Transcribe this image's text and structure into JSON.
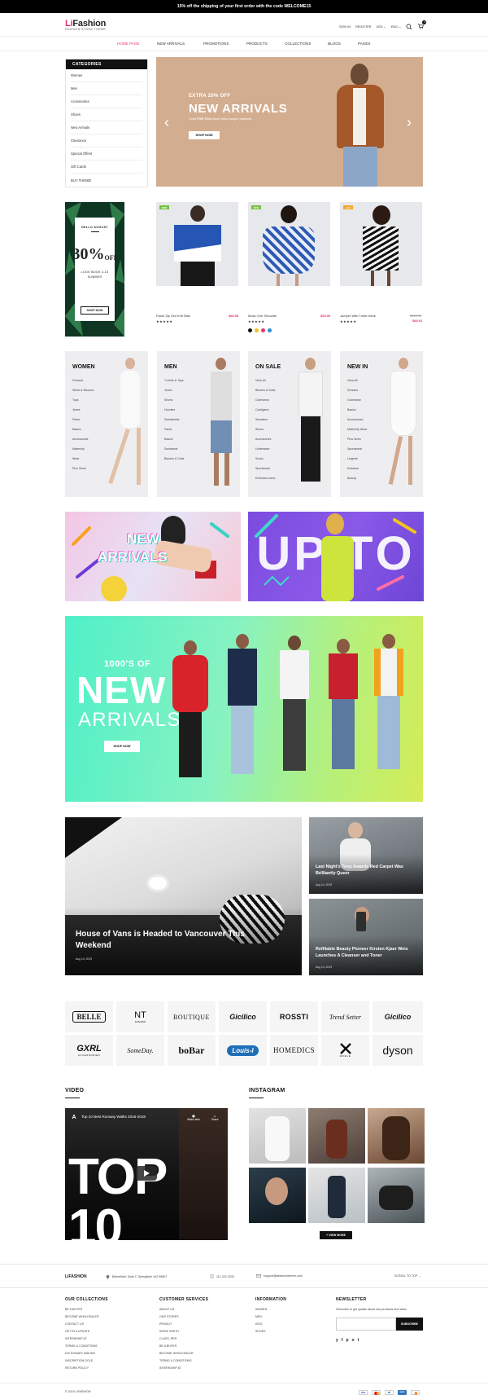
{
  "announcement": "15% off the shipping of your first order with the code WELCOME15",
  "brand": {
    "logo_prefix": "Li",
    "logo_rest": "Fashion",
    "tagline": "FASHION STORE THEME"
  },
  "header_links": {
    "sign_in": "SIGN IN",
    "register": "REGISTER",
    "currency": "USD",
    "language": "ENG",
    "cart_count": "0"
  },
  "nav": [
    "HOME PAGE",
    "NEW ARRIVALS",
    "PROMOTIONS",
    "PRODUCTS",
    "COLLECTIONS",
    "BLOGS",
    "PAGES"
  ],
  "categories": {
    "title": "CATEGORIES",
    "items": [
      "Women",
      "Men",
      "Accessories",
      "Shoes",
      "New Arrivals",
      "Clearance",
      "Special Offers",
      "Gift Cards",
      "BUY THEME!"
    ]
  },
  "hero": {
    "kicker": "EXTRA 20% OFF",
    "title": "NEW ARRIVALS",
    "desc_prefix": "Code",
    "code": "FOR YOU",
    "desc_suffix": "ipsum dolor congue praesent.",
    "button": "SHOP NOW"
  },
  "promo": {
    "kicker": "HELLO AUGUST",
    "big": "30%",
    "off": "OFF",
    "line1": "LOOK BOOK 3-15",
    "line2": "SUMMER",
    "button": "SHOP NOW"
  },
  "products": [
    {
      "badge": "NEW",
      "name": "Panel Zip Zed Knit Raw",
      "price": "$88.95",
      "old_price": ""
    },
    {
      "badge": "NEW",
      "name": "Moss One Shoulder",
      "price": "$68.99",
      "old_price": ""
    },
    {
      "badge": "-10%",
      "name": "Jumper With Turtle Neck",
      "price": "$89.91",
      "old_price": "$118.95"
    }
  ],
  "swatches": [
    "#111111",
    "#f2c01f",
    "#e8336b",
    "#2d8fd5"
  ],
  "category_blocks": [
    {
      "title": "WOMEN",
      "items": [
        "Dresses",
        "Shirts & Blouses",
        "Tops",
        "Jeans",
        "Pants",
        "Basics",
        "Accessories",
        "Maternity",
        "Wear",
        "Plus Sizes"
      ]
    },
    {
      "title": "MEN",
      "items": [
        "T-shirts & Tops",
        "Jeans",
        "Shorts",
        "Hoodies",
        "Sweatshirts",
        "Pants",
        "Basics",
        "Swimwear",
        "Blazers & Suits"
      ]
    },
    {
      "title": "ON SALE",
      "items": [
        "View All",
        "Blazers & Suits",
        "Outerwear",
        "Cardigans",
        "Sweaters",
        "Shoes",
        "Accessories",
        "Underwear",
        "Socks",
        "Sportswear",
        "Extended sizes"
      ]
    },
    {
      "title": "NEW IN",
      "items": [
        "View All",
        "Dresses",
        "Outerwear",
        "Basics",
        "Accessories",
        "Maternity Wear",
        "Plus Sizes",
        "Sportswear",
        "Lingerie",
        "Knitwear",
        "Beauty"
      ]
    }
  ],
  "banners": {
    "left_line1": "NEW",
    "left_line2": "ARRIVALS",
    "right_text": "UP TO"
  },
  "big_banner": {
    "kicker": "1000'S OF",
    "title": "NEW",
    "subtitle": "ARRIVALS",
    "button": "SHOP NOW"
  },
  "blog": {
    "main": {
      "title": "House of Vans is Headed to Vancouver This Weekend",
      "date": "Aug 14, 2019"
    },
    "side": [
      {
        "title": "Last Night's Tony Awards Red Carpet Was Brilliantly Queer",
        "date": "Aug 14, 2019"
      },
      {
        "title": "Refillable Beauty Pioneer Kirsten Kjaer Weis Launches A Cleanser and Toner",
        "date": "Aug 14, 2019"
      }
    ]
  },
  "brands": [
    "BELLE",
    "NT",
    "BOUTIQUE",
    "Gicilico",
    "ROSSTI",
    "Trend Setter",
    "Gicilico",
    "GXRL",
    "SomeDay.",
    "boBar",
    "Louis-I",
    "HOMEDICS",
    "WOHLE",
    "dyson"
  ],
  "brand_subs": {
    "nt": "FASHION",
    "gxrl": "ACCESSORIES"
  },
  "video": {
    "title": "VIDEO",
    "caption": "Top 10 Best Runway Walks 2016-2018",
    "watch_later": "Watch later",
    "share": "Share",
    "big": "TOP 10",
    "channel_initial": "A"
  },
  "instagram": {
    "title": "INSTAGRAM",
    "button": "+ VIEW MORE"
  },
  "footer_info": {
    "brand": "LIFASHION",
    "address": "Bethelfield, Suite C Springfield, MO 65807",
    "phone": "111-222-3333",
    "email": "support@lafashiontheme.com",
    "scroll": "SCROLL TO TOP"
  },
  "footer_cols": [
    {
      "title": "OUR COLLECTIONS",
      "items": [
        "BE A BUYER",
        "BECOME WHOLESALER",
        "CONTACT US",
        "GET IN A UPDATE",
        "INTERNSHIP AT",
        "TERMS & CONDITIONS",
        "DICTIONARY MAKING",
        "INSCRIPTION GOLD",
        "RETURN POLICY"
      ]
    },
    {
      "title": "CUSTOMER SERVICES",
      "items": [
        "ABOUT US",
        "OUR STORES",
        "PRIVACY",
        "WORK WHITH",
        "CLASS, PER",
        "BE A BUYER",
        "BECOME WHOLESALER",
        "TERMS & CONDITIONS",
        "INTERNSHIP AT"
      ]
    },
    {
      "title": "INFORMATION",
      "items": [
        "WOMEN",
        "MEN",
        "KIDS",
        "SHOES"
      ]
    }
  ],
  "newsletter": {
    "title": "NEWSLETTER",
    "text": "Subscribe to get update about new products and sales",
    "placeholder": "",
    "button": "SUBSCRIBE"
  },
  "socials": [
    "y",
    "f",
    "p",
    "o",
    "t"
  ],
  "copyright": "© 2019 LIFASHION",
  "payments": [
    "VISA",
    "MC",
    "PP",
    "AMEX",
    "DIS"
  ],
  "colors": {
    "accent": "#e8336b",
    "dark": "#111111",
    "badge_new": "#76c043",
    "badge_sale": "#f6a623"
  }
}
